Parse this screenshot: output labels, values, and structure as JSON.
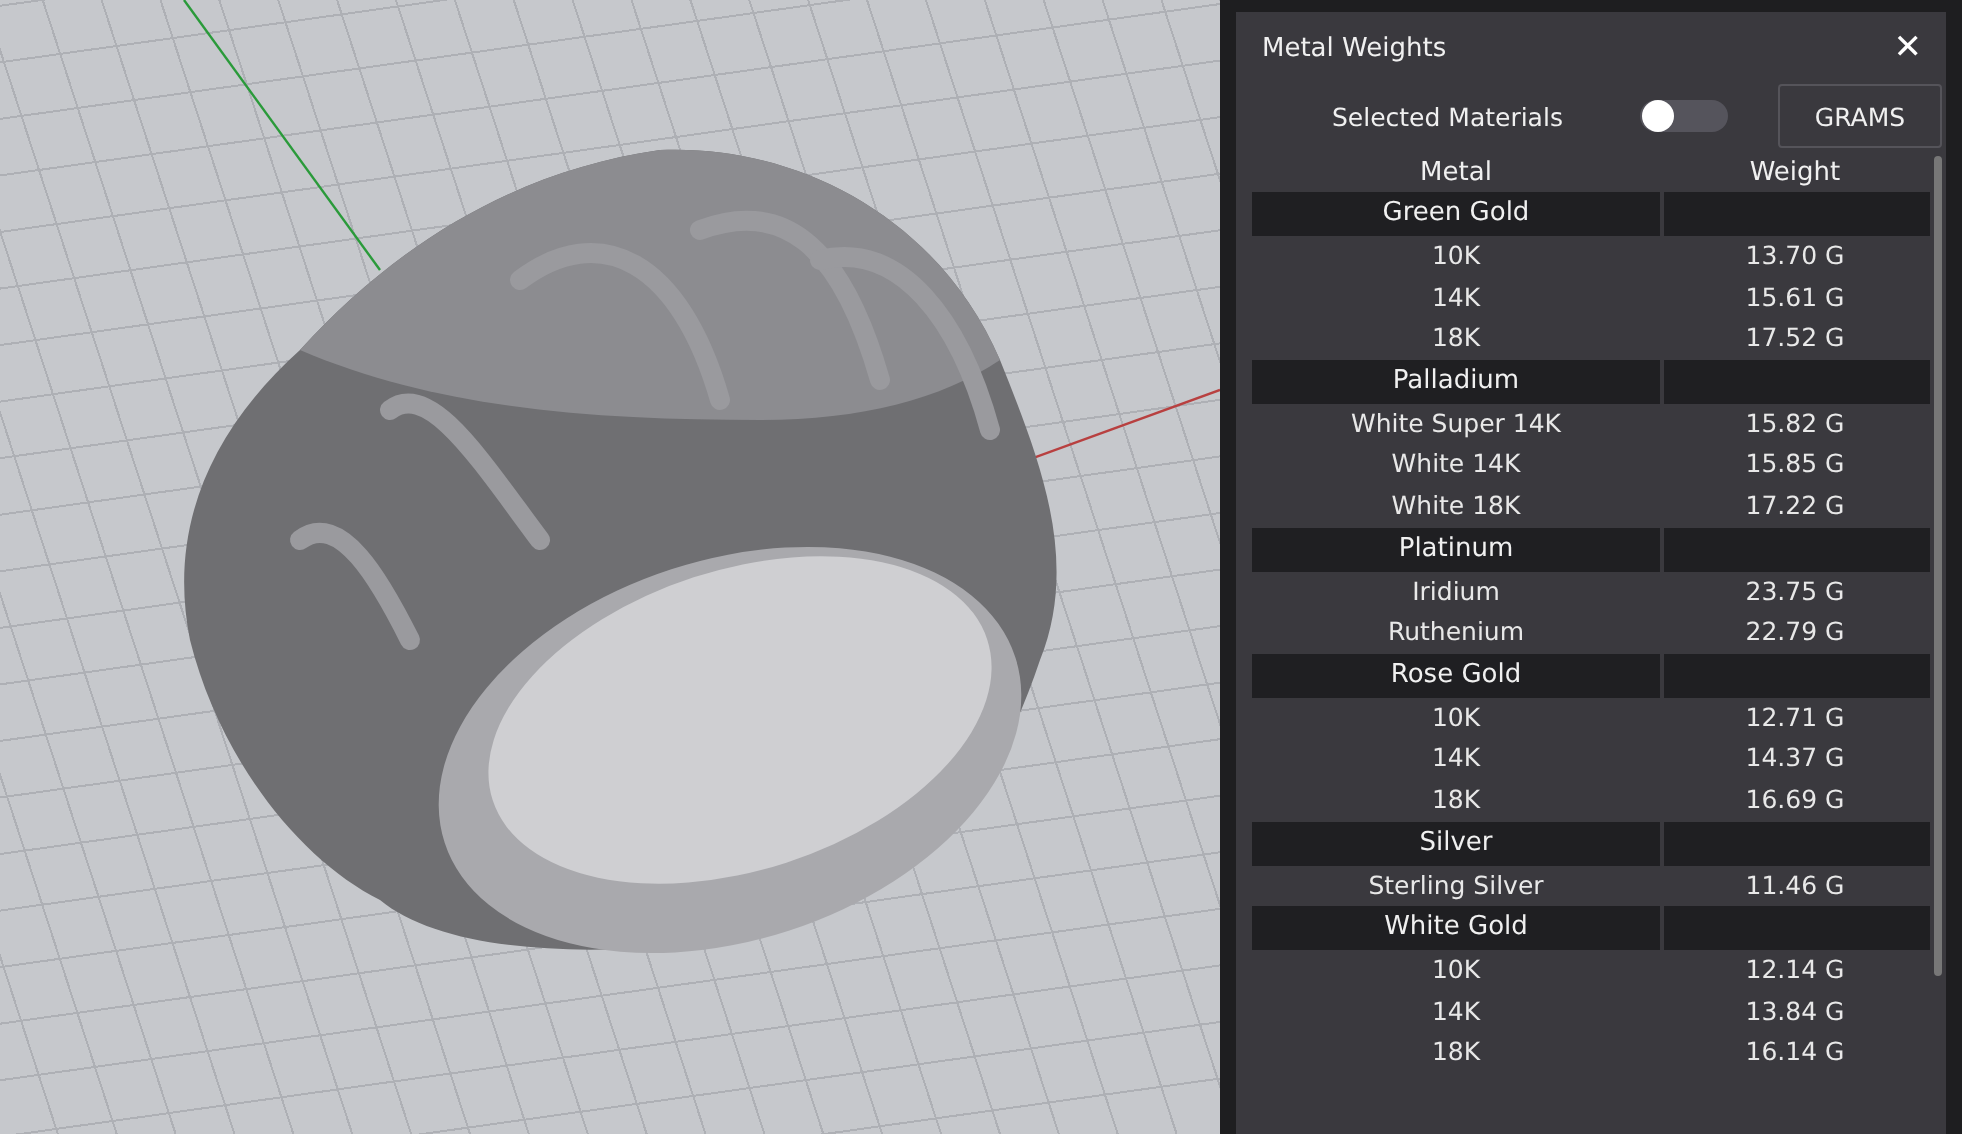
{
  "panel": {
    "title": "Metal Weights",
    "close": "✕",
    "filter_label": "Selected Materials",
    "filter_toggle": {
      "on": false
    },
    "unit_button": "GRAMS"
  },
  "table": {
    "columns": [
      "Metal",
      "Weight"
    ],
    "groups": [
      {
        "name": "Green Gold",
        "rows": [
          {
            "metal": "10K",
            "weight": "13.70 G"
          },
          {
            "metal": "14K",
            "weight": "15.61 G"
          },
          {
            "metal": "18K",
            "weight": "17.52 G"
          }
        ]
      },
      {
        "name": "Palladium",
        "rows": [
          {
            "metal": "White Super 14K",
            "weight": "15.82 G"
          },
          {
            "metal": "White 14K",
            "weight": "15.85 G"
          },
          {
            "metal": "White 18K",
            "weight": "17.22 G"
          }
        ]
      },
      {
        "name": "Platinum",
        "rows": [
          {
            "metal": "Iridium",
            "weight": "23.75 G"
          },
          {
            "metal": "Ruthenium",
            "weight": "22.79 G"
          }
        ]
      },
      {
        "name": "Rose Gold",
        "rows": [
          {
            "metal": "10K",
            "weight": "12.71 G"
          },
          {
            "metal": "14K",
            "weight": "14.37 G"
          },
          {
            "metal": "18K",
            "weight": "16.69 G"
          }
        ]
      },
      {
        "name": "Silver",
        "rows": [
          {
            "metal": "Sterling Silver",
            "weight": "11.46 G"
          }
        ]
      },
      {
        "name": "White Gold",
        "rows": [
          {
            "metal": "10K",
            "weight": "12.14 G"
          },
          {
            "metal": "14K",
            "weight": "13.84 G"
          },
          {
            "metal": "18K",
            "weight": "16.14 G"
          }
        ]
      }
    ]
  }
}
